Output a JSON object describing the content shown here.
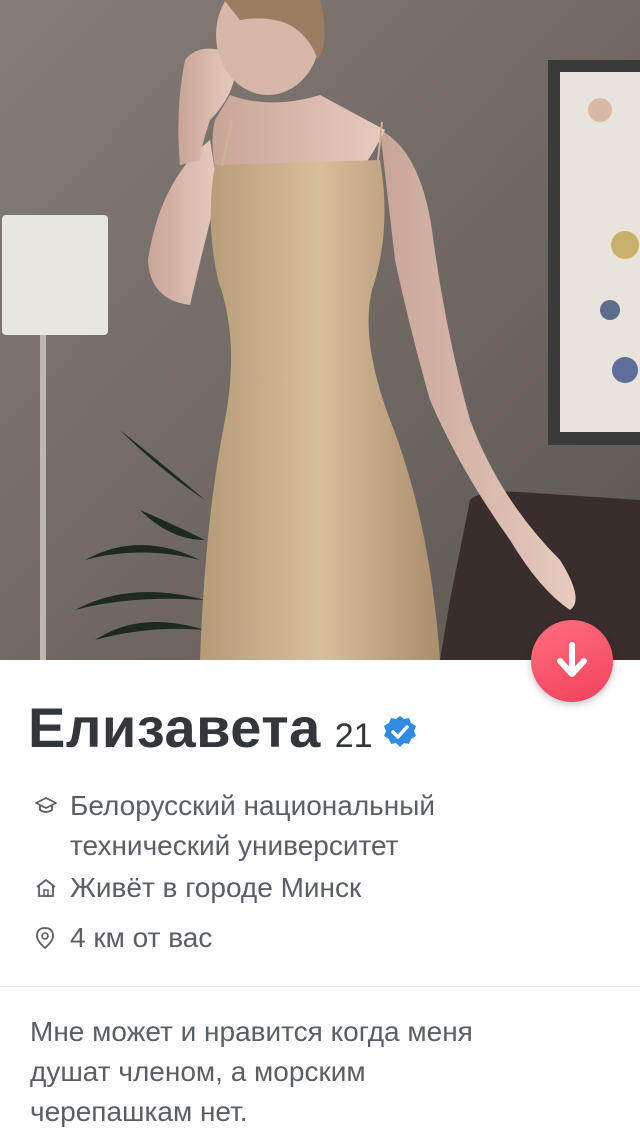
{
  "profile": {
    "name": "Елизавета",
    "age": "21",
    "verified_icon": "verified-badge-icon",
    "school_icon": "graduation-cap-icon",
    "school_line1": "Белорусский национальный",
    "school_line2": "технический университет",
    "home_icon": "home-icon",
    "lives_in": "Живёт в городе Минск",
    "distance_icon": "location-pin-icon",
    "distance": "4 км от вас",
    "bio_line1": "Мне может и нравится когда меня",
    "bio_line2": "душат членом, а морским",
    "bio_line3": "черепашкам нет."
  },
  "actions": {
    "collapse_icon": "arrow-down-icon"
  },
  "colors": {
    "accent": "#f2405e",
    "verified": "#2f8be6",
    "text_dark": "#33363b",
    "text_muted": "#5a5e65"
  }
}
